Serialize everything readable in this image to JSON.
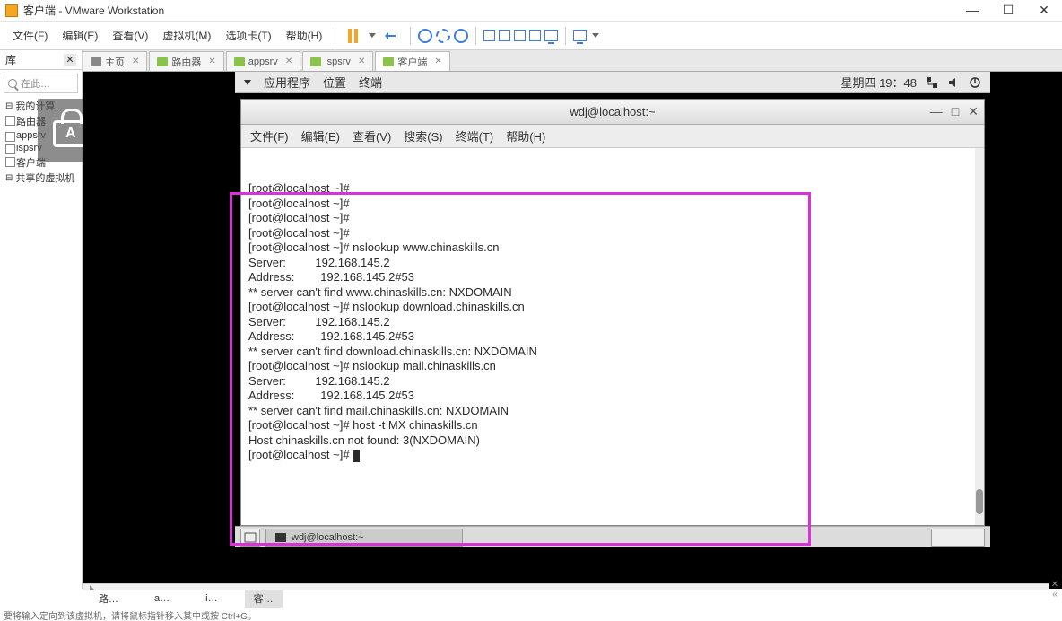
{
  "window": {
    "title": "客户端 - VMware Workstation",
    "btn_min": "—",
    "btn_max": "☐",
    "btn_close": "✕"
  },
  "menu": {
    "file": "文件(F)",
    "edit": "编辑(E)",
    "view": "查看(V)",
    "vm": "虚拟机(M)",
    "tabs": "选项卡(T)",
    "help": "帮助(H)"
  },
  "library": {
    "header": "库",
    "search_ph": "在此…",
    "root": "我的计算…",
    "items": [
      "路由器",
      "appsrv",
      "ispsrv",
      "客户端"
    ],
    "shared": "共享的虚拟机"
  },
  "vmtabs": {
    "home": "主页",
    "t1": "路由器",
    "t2": "appsrv",
    "t3": "ispsrv",
    "t4": "客户端"
  },
  "gnome": {
    "apps": "应用程序",
    "places": "位置",
    "term": "终端",
    "clock": "星期四 19：48"
  },
  "terminal": {
    "title": "wdj@localhost:~",
    "m_file": "文件(F)",
    "m_edit": "编辑(E)",
    "m_view": "查看(V)",
    "m_search": "搜索(S)",
    "m_terminal": "终端(T)",
    "m_help": "帮助(H)",
    "lines": [
      "[root@localhost ~]# ",
      "[root@localhost ~]# ",
      "[root@localhost ~]# ",
      "[root@localhost ~]# ",
      "[root@localhost ~]# nslookup www.chinaskills.cn",
      "Server:         192.168.145.2",
      "Address:        192.168.145.2#53",
      "",
      "** server can't find www.chinaskills.cn: NXDOMAIN",
      "",
      "[root@localhost ~]# nslookup download.chinaskills.cn",
      "Server:         192.168.145.2",
      "Address:        192.168.145.2#53",
      "",
      "** server can't find download.chinaskills.cn: NXDOMAIN",
      "",
      "[root@localhost ~]# nslookup mail.chinaskills.cn",
      "Server:         192.168.145.2",
      "Address:        192.168.145.2#53",
      "",
      "** server can't find mail.chinaskills.cn: NXDOMAIN",
      "",
      "[root@localhost ~]# host -t MX chinaskills.cn",
      "Host chinaskills.cn not found: 3(NXDOMAIN)",
      "[root@localhost ~]# "
    ],
    "task_label": "wdj@localhost:~"
  },
  "bottom_tabs": {
    "t1": "路…",
    "t2": "a…",
    "t3": "i…",
    "t4": "客…"
  },
  "status_text": "要将输入定向到该虚拟机，请将鼠标指针移入其中或按 Ctrl+G。"
}
